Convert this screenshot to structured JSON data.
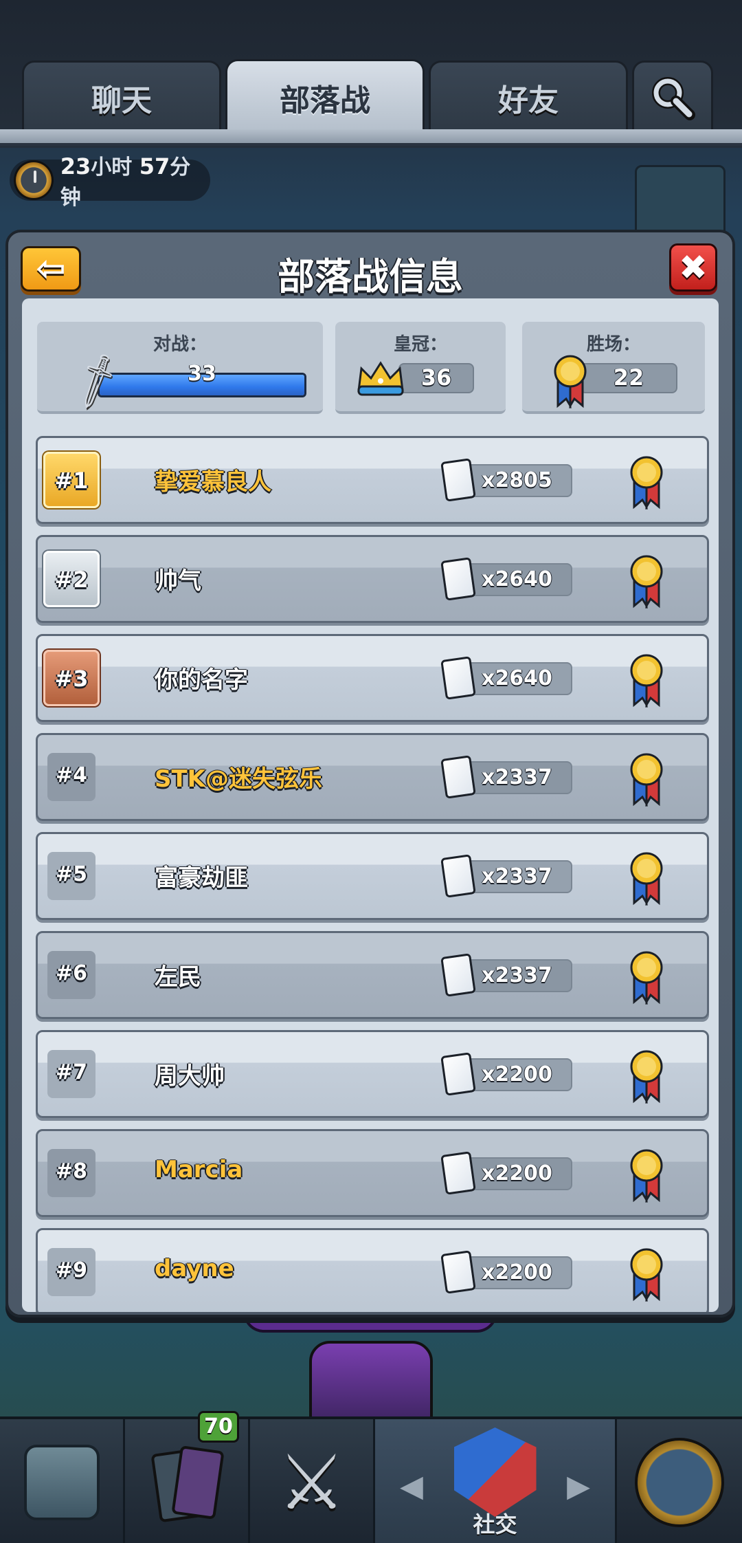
{
  "tabs": [
    {
      "label": "聊天",
      "active": false
    },
    {
      "label": "部落战",
      "active": true
    },
    {
      "label": "好友",
      "active": false
    }
  ],
  "timer": {
    "hours": "23",
    "hours_unit": "小时",
    "minutes": "57",
    "minutes_unit": "分钟"
  },
  "modal": {
    "title": "部落战信息",
    "back_label": "⇦",
    "close_label": "✖",
    "stats": {
      "battles": {
        "label": "对战：",
        "value": "33",
        "progress": 1.0
      },
      "crowns": {
        "label": "皇冠：",
        "value": "36"
      },
      "wins": {
        "label": "胜场：",
        "value": "22"
      }
    },
    "rows": [
      {
        "rank": "#1",
        "name": "挚爱慕良人",
        "cards": "x2805",
        "tier": "gold",
        "name_color": "gold"
      },
      {
        "rank": "#2",
        "name": "帅气",
        "cards": "x2640",
        "tier": "silver",
        "name_color": "white"
      },
      {
        "rank": "#3",
        "name": "你的名字",
        "cards": "x2640",
        "tier": "bronze",
        "name_color": "white"
      },
      {
        "rank": "#4",
        "name": "STK@迷失弦乐",
        "cards": "x2337",
        "tier": "plain",
        "name_color": "gold"
      },
      {
        "rank": "#5",
        "name": "富豪劫匪",
        "cards": "x2337",
        "tier": "plain",
        "name_color": "white"
      },
      {
        "rank": "#6",
        "name": "左民",
        "cards": "x2337",
        "tier": "plain",
        "name_color": "white"
      },
      {
        "rank": "#7",
        "name": "周大帅",
        "cards": "x2200",
        "tier": "plain",
        "name_color": "white"
      },
      {
        "rank": "#8",
        "name": "Marcia",
        "cards": "x2200",
        "tier": "plain",
        "name_color": "gold"
      },
      {
        "rank": "#9",
        "name": "dayne",
        "cards": "x2200",
        "tier": "plain",
        "name_color": "gold"
      }
    ]
  },
  "bottom_nav": {
    "cards_badge": "70",
    "social_label": "社交"
  },
  "colors": {
    "accent_gold": "#ffc33a",
    "back_button": "#f09a15",
    "close_button": "#c2201c",
    "progress_blue": "#2f78ea"
  }
}
